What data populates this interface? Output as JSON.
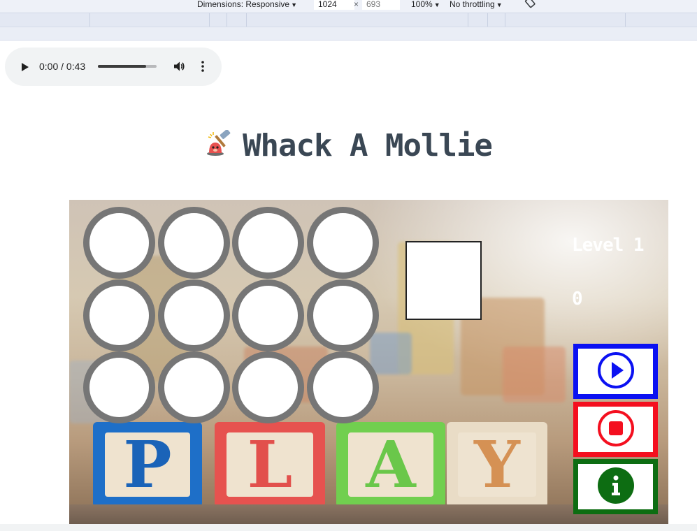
{
  "devtools": {
    "dimensions_label": "Dimensions: Responsive",
    "width_value": "1024",
    "times": "×",
    "height_placeholder": "693",
    "zoom": "100%",
    "throttling": "No throttling"
  },
  "audio": {
    "time": "0:00 / 0:43",
    "progress": 0.82
  },
  "page": {
    "title": "Whack A Mollie"
  },
  "game": {
    "level_label": "Level 1",
    "score": "0",
    "hole_count": 12,
    "background_letters": [
      "P",
      "L",
      "A",
      "Y"
    ]
  },
  "controls": {
    "play_icon": "play-circle-icon",
    "stop_icon": "stop-circle-icon",
    "info_icon": "info-icon",
    "colors": {
      "play": "#0b11f2",
      "stop": "#f40f1f",
      "info": "#0d6d12"
    }
  }
}
